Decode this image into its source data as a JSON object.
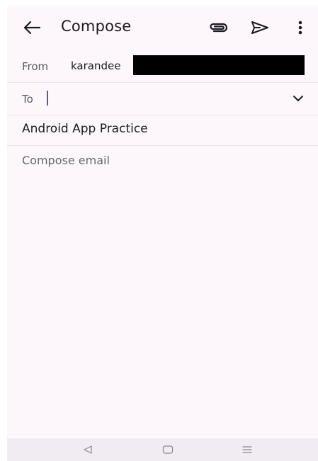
{
  "appbar": {
    "title": "Compose",
    "icons": [
      "back-arrow-icon",
      "attachment-icon",
      "send-icon",
      "more-vert-icon"
    ]
  },
  "form": {
    "from_label": "From",
    "from_value": "karandee",
    "to_label": "To",
    "to_value": "",
    "subject_value": "Android App Practice",
    "body_placeholder": "Compose email"
  },
  "navbar": {
    "icons": [
      "nav-back-icon",
      "nav-home-icon",
      "nav-recents-icon"
    ]
  },
  "colors": {
    "background": "#fdf7fc",
    "cursor": "#6750a4",
    "text": "#1c1b1f",
    "muted": "#5c5a60",
    "navbar": "#f1ecf2"
  }
}
